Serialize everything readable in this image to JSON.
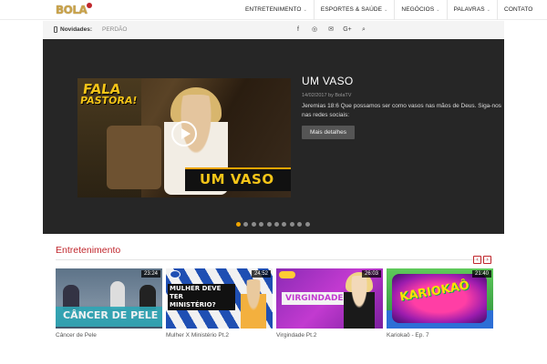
{
  "header": {
    "logo_text": "BOLA",
    "menu": [
      {
        "label": "ENTRETENIMENTO",
        "dropdown": true
      },
      {
        "label": "ESPORTES & SAÚDE",
        "dropdown": true
      },
      {
        "label": "NEGÓCIOS",
        "dropdown": true
      },
      {
        "label": "PALAVRAS",
        "dropdown": true
      },
      {
        "label": "CONTATO",
        "dropdown": false
      }
    ]
  },
  "news": {
    "label": "Novidades:",
    "text": "PERDÃO"
  },
  "social_icons": [
    "facebook-icon",
    "instagram-icon",
    "email-icon",
    "google-plus-icon",
    "search-icon"
  ],
  "hero": {
    "thumb_text_top": "FALA",
    "thumb_text_mid": "PASTORA!",
    "thumb_banner": "UM VASO",
    "title": "UM VASO",
    "meta": "14/02/2017 by BolaTV",
    "description": "Jeremias 18:6 Que possamos ser como vasos nas mãos de Deus. Siga-nos nas redes sociais:",
    "button": "Mais detalhes",
    "slide_count": 10,
    "active_slide": 0
  },
  "section": {
    "title": "Entretenimento",
    "prev": "‹",
    "next": "›",
    "cards": [
      {
        "duration": "23:24",
        "caption": "Câncer de Pele",
        "overlay": "CÂNCER DE PELE"
      },
      {
        "duration": "24:52",
        "caption": "Mulher X Ministério Pt.2",
        "overlay_lines": [
          "MULHER DEVE TER",
          "MINISTÉRIO?"
        ]
      },
      {
        "duration": "26:03",
        "caption": "Virgindade Pt.2",
        "overlay": "VIRGINDADE"
      },
      {
        "duration": "21:40",
        "caption": "Kariokaô - Ep. 7",
        "overlay": "KARIOKAÔ"
      }
    ]
  },
  "colors": {
    "accent": "#c0272d",
    "gold": "#f0a500",
    "hero_bg": "#262626"
  }
}
